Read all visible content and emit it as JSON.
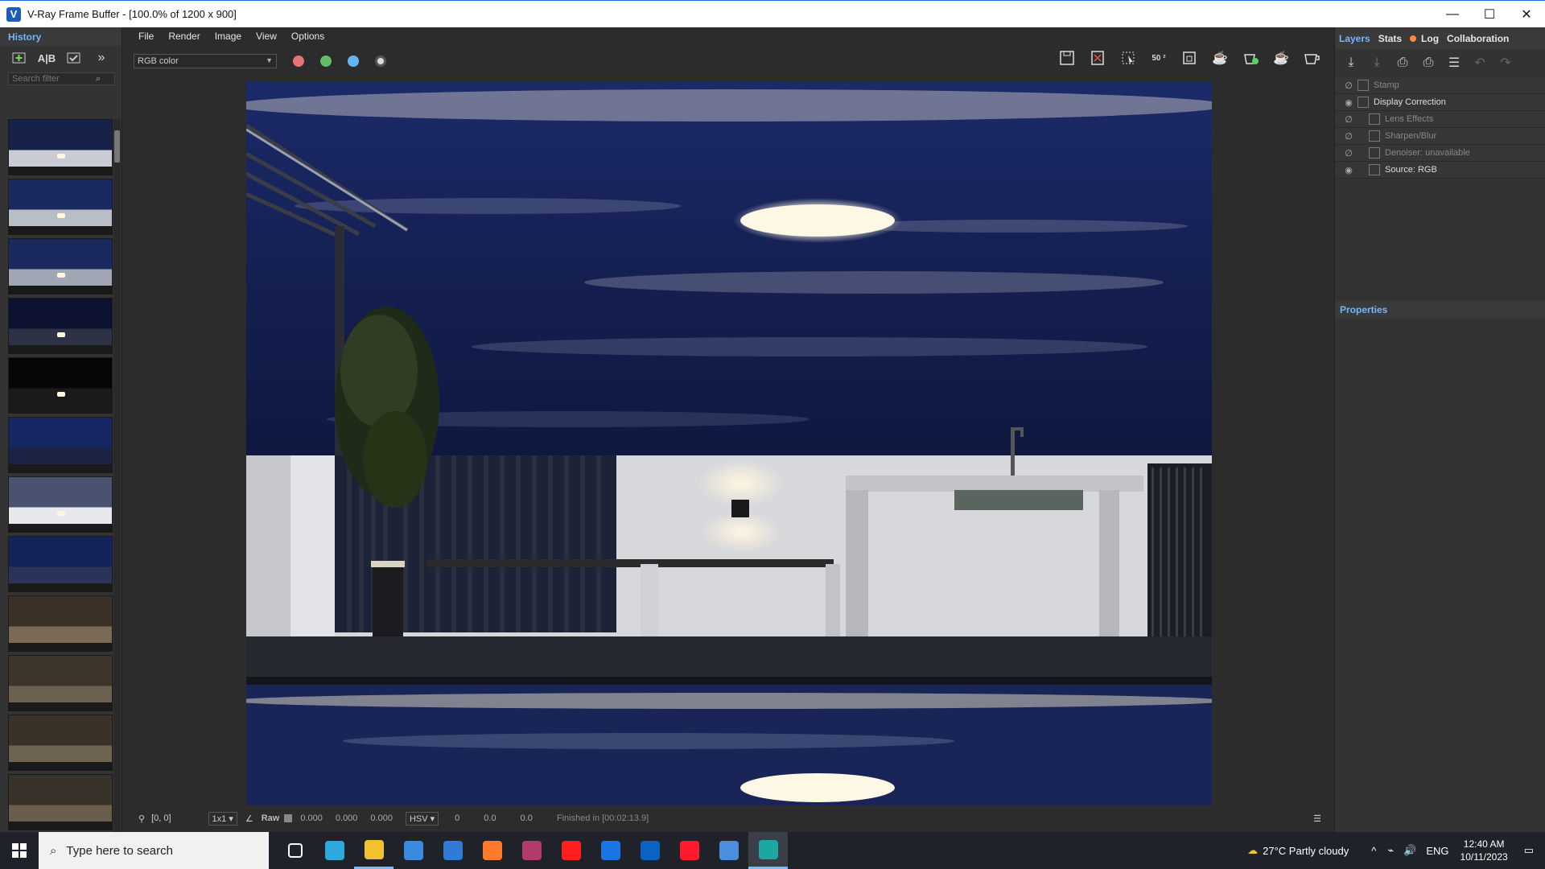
{
  "window": {
    "title": "V-Ray Frame Buffer - [100.0% of 1200 x 900]",
    "buttons": [
      "—",
      "☐",
      "✕"
    ]
  },
  "history": {
    "tab": "History",
    "search_placeholder": "Search filter",
    "thumbnails": [
      {
        "sky": "#16224a",
        "mid": "#c9ccd4",
        "light": true
      },
      {
        "sky": "#1a2a60",
        "mid": "#b8bdc8",
        "light": true
      },
      {
        "sky": "#1a2a5e",
        "mid": "#a0a6b4",
        "light": true
      },
      {
        "sky": "#0c1230",
        "mid": "#2c3146",
        "light": true
      },
      {
        "sky": "#060608",
        "mid": "#1a1a1a",
        "light": true
      },
      {
        "sky": "#152663",
        "mid": "#1b2344",
        "light": false
      },
      {
        "sky": "#4a5270",
        "mid": "#e6e8ee",
        "light": true
      },
      {
        "sky": "#14235a",
        "mid": "#2a335a",
        "light": false
      },
      {
        "sky": "#3b3026",
        "mid": "#7a6a55",
        "light": false
      },
      {
        "sky": "#3d352c",
        "mid": "#6c6050",
        "light": false
      },
      {
        "sky": "#3a3229",
        "mid": "#6e6350",
        "light": false
      },
      {
        "sky": "#39322a",
        "mid": "#6a5d4c",
        "light": false
      }
    ]
  },
  "menu": [
    "File",
    "Render",
    "Image",
    "View",
    "Options"
  ],
  "toolbar": {
    "channel": "RGB color",
    "channel_colors": [
      "#e57373",
      "#66bb6a",
      "#64b5f6"
    ]
  },
  "status": {
    "coords": "[0, 0]",
    "zoom": "1x1",
    "raw": "Raw",
    "rgb": [
      "0.000",
      "0.000",
      "0.000"
    ],
    "color_mode": "HSV",
    "hsv": [
      "0",
      "0.0",
      "0.0"
    ],
    "finished": "Finished in [00:02:13.9]"
  },
  "right_panel": {
    "tabs": [
      "Layers",
      "Stats",
      "Log",
      "Collaboration"
    ],
    "layers": [
      {
        "label": "Stamp",
        "dim": true,
        "eye": false
      },
      {
        "label": "Display Correction",
        "dim": false,
        "eye": true
      },
      {
        "label": "Lens Effects",
        "dim": true,
        "eye": false
      },
      {
        "label": "Sharpen/Blur",
        "dim": true,
        "eye": false
      },
      {
        "label": "Denoiser: unavailable",
        "dim": true,
        "eye": false
      },
      {
        "label": "Source: RGB",
        "dim": false,
        "eye": true
      }
    ],
    "properties_label": "Properties"
  },
  "taskbar": {
    "search_placeholder": "Type here to search",
    "apps": [
      {
        "name": "task-view-icon",
        "color": "#ffffff"
      },
      {
        "name": "edge-icon",
        "color": "#2ea8df"
      },
      {
        "name": "file-explorer-icon",
        "color": "#f2c12e"
      },
      {
        "name": "store-icon",
        "color": "#3a8be0"
      },
      {
        "name": "mail-icon",
        "color": "#2f7bd6"
      },
      {
        "name": "firefox-icon",
        "color": "#ff7a2c"
      },
      {
        "name": "winrar-icon",
        "color": "#b33a6a"
      },
      {
        "name": "youtube-icon",
        "color": "#ff1f1f"
      },
      {
        "name": "facebook-icon",
        "color": "#1b74e4"
      },
      {
        "name": "outlook-icon",
        "color": "#0a64c6"
      },
      {
        "name": "opera-icon",
        "color": "#ff1b2d"
      },
      {
        "name": "app-store-icon",
        "color": "#4c8dde"
      },
      {
        "name": "3dsmax-icon",
        "color": "#1ba8a3"
      }
    ],
    "weather": "27°C  Partly cloudy",
    "language": "ENG",
    "time": "12:40 AM",
    "date": "10/11/2023"
  }
}
